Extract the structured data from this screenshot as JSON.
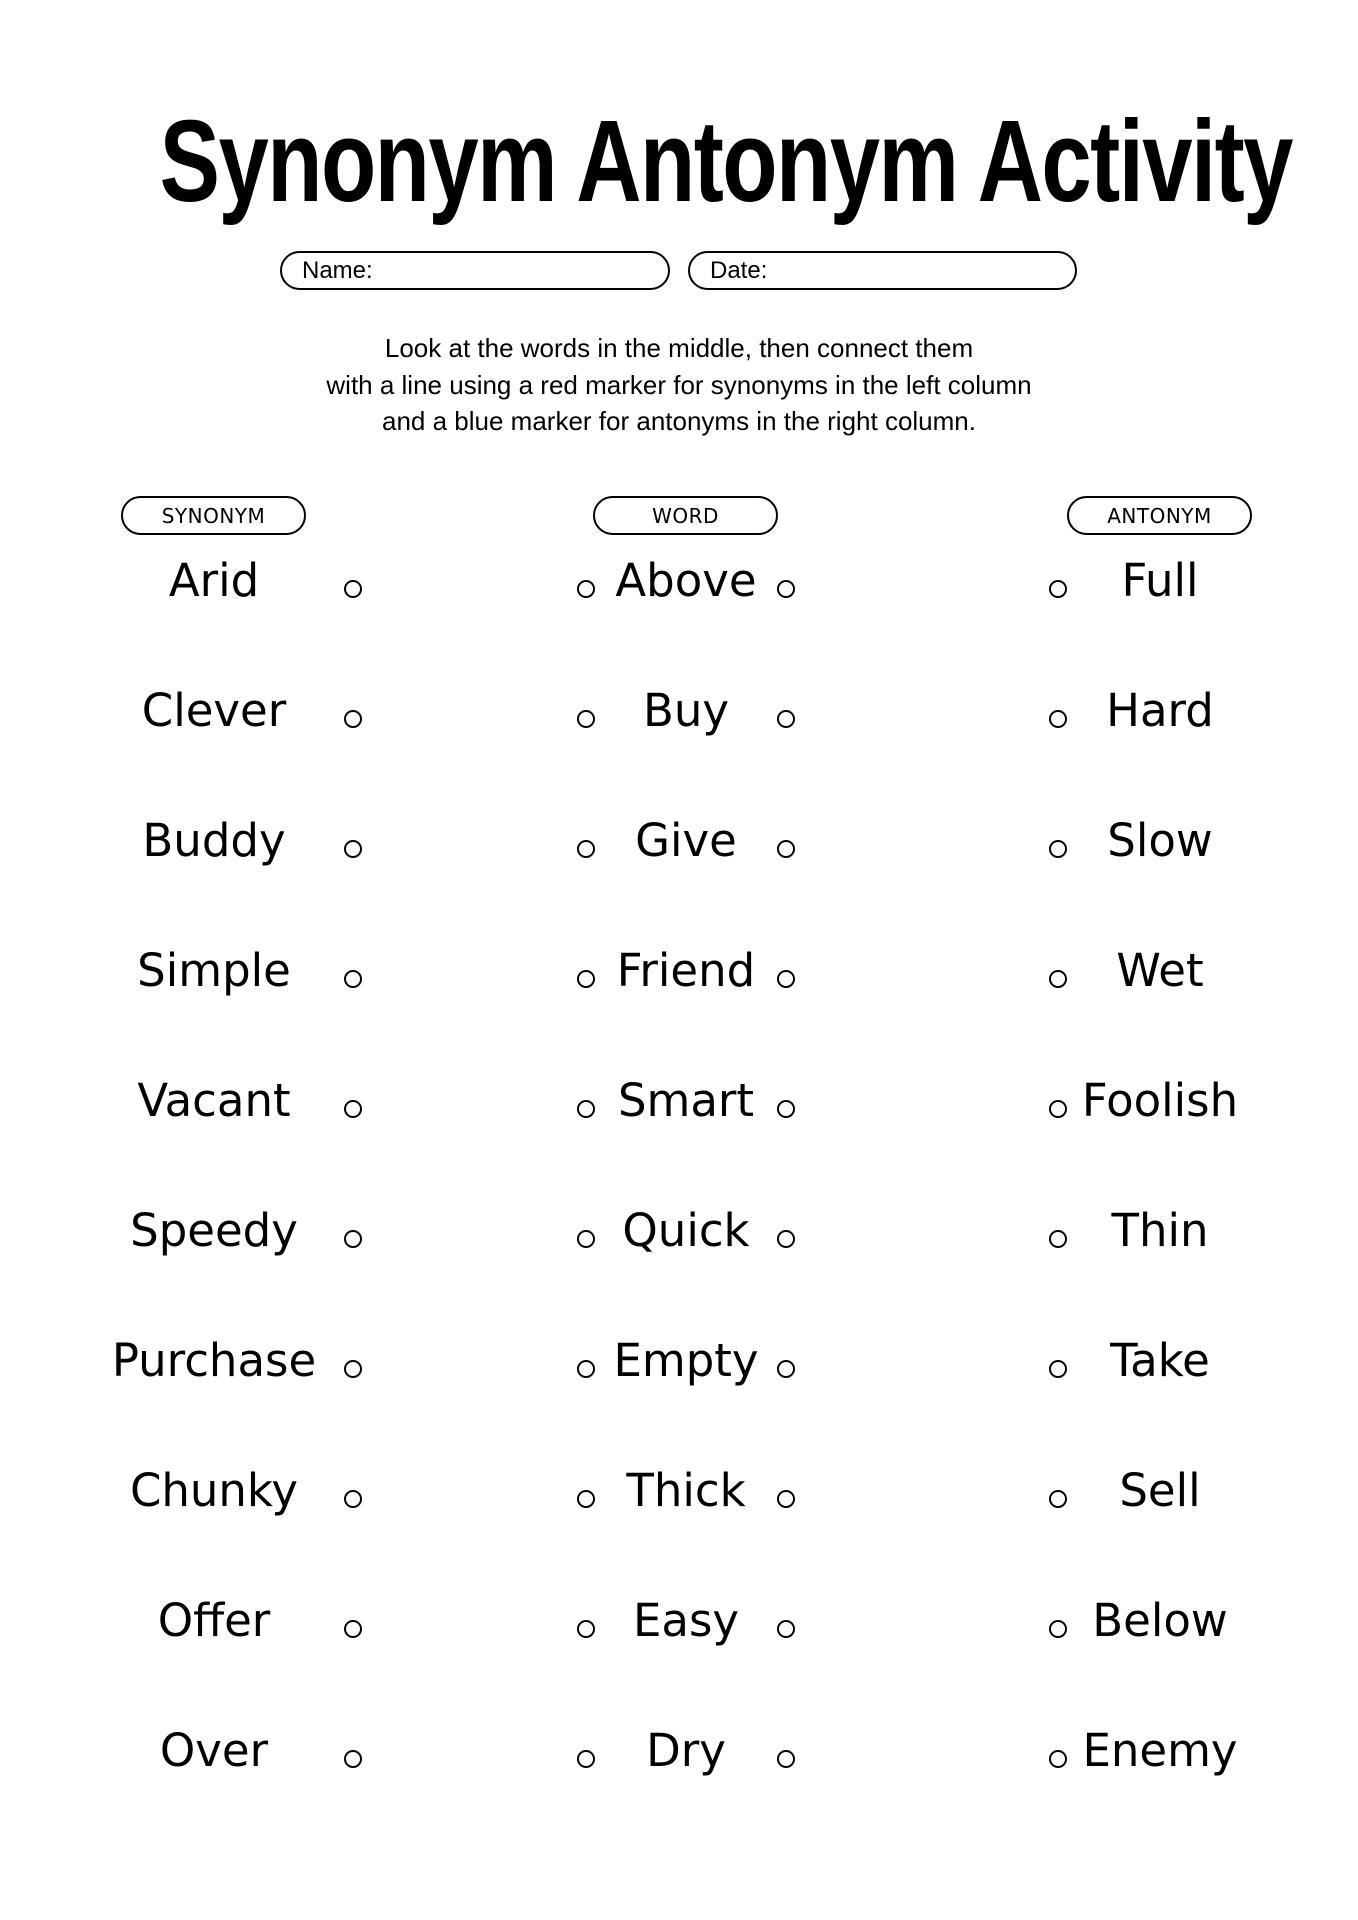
{
  "title": "Synonym Antonym Activity",
  "fields": {
    "name_label": "Name:",
    "date_label": "Date:",
    "name_value": "",
    "date_value": ""
  },
  "instructions": [
    "Look at the words in the middle, then connect them",
    "with a line using a red marker for synonyms in the left column",
    "and a blue marker for antonyms in the right column."
  ],
  "columns": {
    "synonym_header": "SYNONYM",
    "word_header": "WORD",
    "antonym_header": "ANTONYM"
  },
  "rows": [
    {
      "synonym": "Arid",
      "word": "Above",
      "antonym": "Full"
    },
    {
      "synonym": "Clever",
      "word": "Buy",
      "antonym": "Hard"
    },
    {
      "synonym": "Buddy",
      "word": "Give",
      "antonym": "Slow"
    },
    {
      "synonym": "Simple",
      "word": "Friend",
      "antonym": "Wet"
    },
    {
      "synonym": "Vacant",
      "word": "Smart",
      "antonym": "Foolish"
    },
    {
      "synonym": "Speedy",
      "word": "Quick",
      "antonym": "Thin"
    },
    {
      "synonym": "Purchase",
      "word": "Empty",
      "antonym": "Take"
    },
    {
      "synonym": "Chunky",
      "word": "Thick",
      "antonym": "Sell"
    },
    {
      "synonym": "Offer",
      "word": "Easy",
      "antonym": "Below"
    },
    {
      "synonym": "Over",
      "word": "Dry",
      "antonym": "Enemy"
    }
  ],
  "connector_icon": "circle-outline-icon"
}
